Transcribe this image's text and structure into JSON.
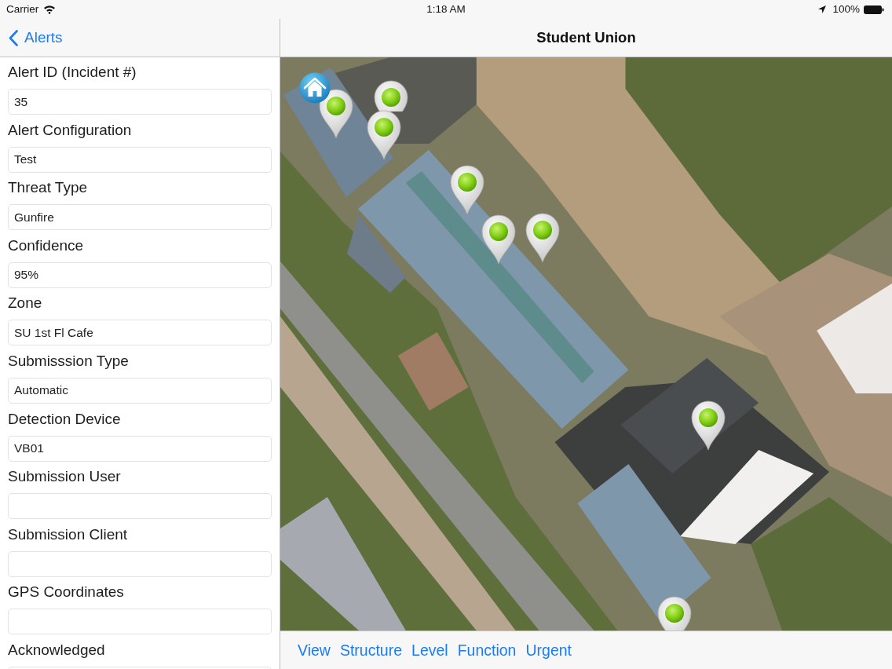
{
  "status_bar": {
    "carrier": "Carrier",
    "time": "1:18 AM",
    "battery": "100%"
  },
  "sidebar": {
    "back_button": "Alerts",
    "fields": [
      {
        "label": "Alert ID (Incident #)",
        "value": "35"
      },
      {
        "label": "Alert Configuration",
        "value": "Test"
      },
      {
        "label": "Threat Type",
        "value": "Gunfire"
      },
      {
        "label": "Confidence",
        "value": "95%"
      },
      {
        "label": "Zone",
        "value": "SU 1st Fl Cafe"
      },
      {
        "label": "Submisssion Type",
        "value": "Automatic"
      },
      {
        "label": "Detection Device",
        "value": "VB01"
      },
      {
        "label": "Submission User"
      },
      {
        "label": "Submission Client"
      },
      {
        "label": "GPS Coordinates"
      },
      {
        "label": "Acknowledged"
      }
    ]
  },
  "map": {
    "title": "Student Union",
    "markers": [
      {
        "kind": "home"
      },
      {
        "kind": "sensor"
      },
      {
        "kind": "sensor"
      },
      {
        "kind": "sensor"
      },
      {
        "kind": "sensor"
      },
      {
        "kind": "sensor"
      },
      {
        "kind": "sensor"
      },
      {
        "kind": "sensor"
      },
      {
        "kind": "sensor"
      }
    ]
  },
  "toolbar": {
    "buttons": [
      "View",
      "Structure",
      "Level",
      "Function",
      "Urgent"
    ]
  }
}
